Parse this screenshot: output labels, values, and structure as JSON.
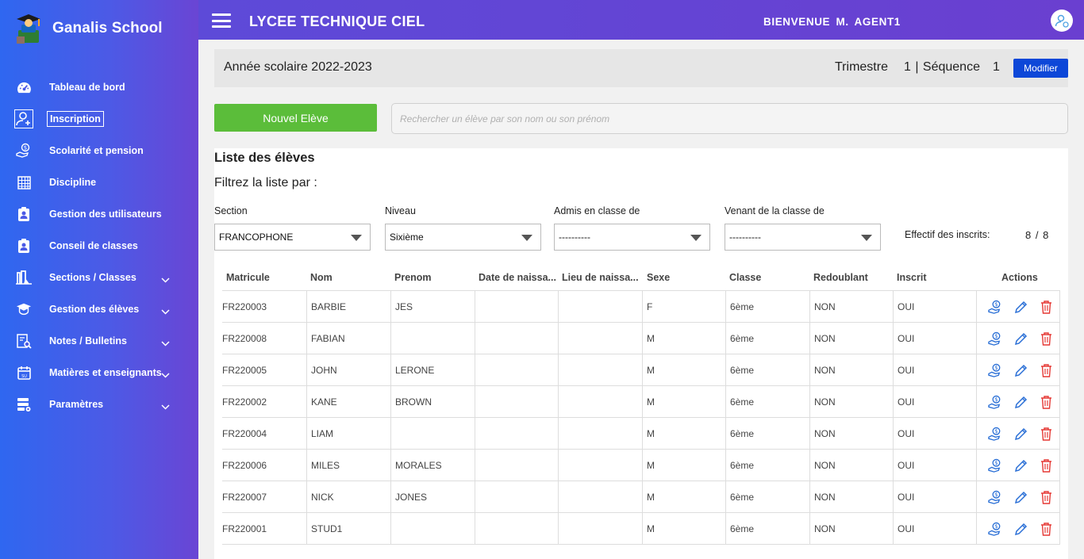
{
  "brand": {
    "title": "Ganalis School"
  },
  "sidebar": {
    "items": [
      {
        "label": "Tableau de bord",
        "icon": "dashboard-gauge-icon"
      },
      {
        "label": "Inscription",
        "icon": "user-plus-icon"
      },
      {
        "label": "Scolarité et pension",
        "icon": "money-hand-icon"
      },
      {
        "label": "Discipline",
        "icon": "calendar-grid-icon"
      },
      {
        "label": "Gestion des utilisateurs",
        "icon": "badge-user-icon"
      },
      {
        "label": "Conseil de classes",
        "icon": "badge-user-icon"
      },
      {
        "label": "Sections / Classes",
        "icon": "school-building-icon"
      },
      {
        "label": "Gestion des élèves",
        "icon": "graduation-cap-icon"
      },
      {
        "label": "Notes / Bulletins",
        "icon": "search-document-icon"
      },
      {
        "label": "Matières et enseignants",
        "icon": "calendar-icon"
      },
      {
        "label": "Paramètres",
        "icon": "settings-stack-icon"
      }
    ]
  },
  "topbar": {
    "school_name": "LYCEE TECHNIQUE CIEL",
    "welcome": "BIENVENUE  M.  AGENT1"
  },
  "yearbar": {
    "year_text": "Année scolaire 2022-2023",
    "trimestre_label": "Trimestre",
    "trimestre_value": "1 | Séquence",
    "sequence_value": "1",
    "modify_label": "Modifier"
  },
  "actions": {
    "new_student_label": "Nouvel Elève",
    "search_placeholder": "Rechercher un élève par son nom ou son prénom"
  },
  "list": {
    "title": "Liste des élèves",
    "filter_label": "Filtrez la liste par :",
    "filters": {
      "section_label": "Section",
      "section_value": "FRANCOPHONE",
      "niveau_label": "Niveau",
      "niveau_value": "Sixième",
      "admis_label": "Admis en classe de",
      "admis_value": "----------",
      "venant_label": "Venant de la classe de",
      "venant_value": "----------"
    },
    "effectif_label": "Effectif des inscrits:",
    "effectif_value": "8 / 8",
    "columns": {
      "matricule": "Matricule",
      "nom": "Nom",
      "prenom": "Prenom",
      "date": "Date de naissa...",
      "lieu": "Lieu de naissa...",
      "sexe": "Sexe",
      "classe": "Classe",
      "redoublant": "Redoublant",
      "inscrit": "Inscrit",
      "actions": "Actions"
    },
    "rows": [
      {
        "matricule": "FR220003",
        "nom": "BARBIE",
        "prenom": "JES",
        "date": "",
        "lieu": "",
        "sexe": "F",
        "classe": "6ème",
        "redoublant": "NON",
        "inscrit": "OUI"
      },
      {
        "matricule": "FR220008",
        "nom": "FABIAN",
        "prenom": "",
        "date": "",
        "lieu": "",
        "sexe": "M",
        "classe": "6ème",
        "redoublant": "NON",
        "inscrit": "OUI"
      },
      {
        "matricule": "FR220005",
        "nom": "JOHN",
        "prenom": "LERONE",
        "date": "",
        "lieu": "",
        "sexe": "M",
        "classe": "6ème",
        "redoublant": "NON",
        "inscrit": "OUI"
      },
      {
        "matricule": "FR220002",
        "nom": "KANE",
        "prenom": "BROWN",
        "date": "",
        "lieu": "",
        "sexe": "M",
        "classe": "6ème",
        "redoublant": "NON",
        "inscrit": "OUI"
      },
      {
        "matricule": "FR220004",
        "nom": "LIAM",
        "prenom": "",
        "date": "",
        "lieu": "",
        "sexe": "M",
        "classe": "6ème",
        "redoublant": "NON",
        "inscrit": "OUI"
      },
      {
        "matricule": "FR220006",
        "nom": "MILES",
        "prenom": "MORALES",
        "date": "",
        "lieu": "",
        "sexe": "M",
        "classe": "6ème",
        "redoublant": "NON",
        "inscrit": "OUI"
      },
      {
        "matricule": "FR220007",
        "nom": "NICK",
        "prenom": "JONES",
        "date": "",
        "lieu": "",
        "sexe": "M",
        "classe": "6ème",
        "redoublant": "NON",
        "inscrit": "OUI"
      },
      {
        "matricule": "FR220001",
        "nom": "STUD1",
        "prenom": "",
        "date": "",
        "lieu": "",
        "sexe": "M",
        "classe": "6ème",
        "redoublant": "NON",
        "inscrit": "OUI"
      }
    ]
  },
  "colors": {
    "sidebar_start": "#2f67f0",
    "sidebar_end": "#6a45d4",
    "topbar": "#6341d2",
    "modifier_button": "#0d47d8",
    "new_button": "#5bbd3a",
    "edit_icon": "#2a6fd6",
    "delete_icon": "#e53935"
  }
}
